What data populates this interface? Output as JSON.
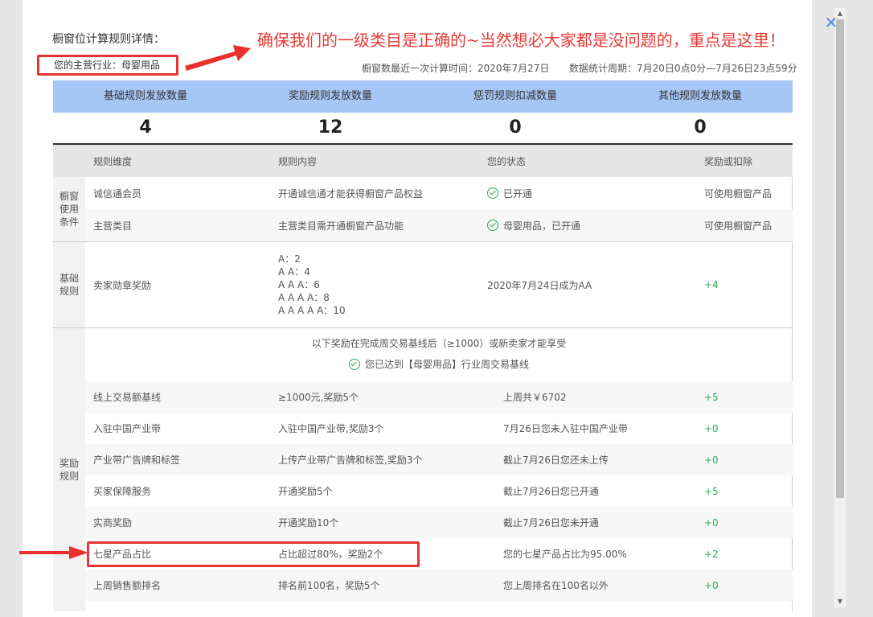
{
  "modal": {
    "title": "橱窗位计算规则详情：",
    "annotation": "确保我们的一级类目是正确的~当然想必大家都是没问题的，重点是这里！",
    "industry_label": "您的主营行业：",
    "industry_value": "母婴用品",
    "calc_time": "橱窗数最近一次计算时间：2020年7月27日",
    "period": "数据统计周期：7月20日0点0分—7月26日23点59分",
    "close_icon": "close-icon"
  },
  "summary": {
    "headers": [
      "基础规则发放数量",
      "奖励规则发放数量",
      "惩罚规则扣减数量",
      "其他规则发放数量"
    ],
    "values": [
      "4",
      "12",
      "0",
      "0"
    ]
  },
  "table": {
    "headers": [
      "规则维度",
      "规则内容",
      "您的状态",
      "奖励或扣除"
    ],
    "groups": {
      "usage": [
        "橱窗",
        "使用",
        "条件"
      ],
      "basic": [
        "基础",
        "规则"
      ],
      "reward": [
        "奖励",
        "规则"
      ]
    },
    "usage_rows": [
      {
        "dimension": "诚信通会员",
        "content": "开通诚信通才能获得橱窗产品权益",
        "status": "已开通",
        "result": "可使用橱窗产品"
      },
      {
        "dimension": "主营类目",
        "content": "主营类目需开通橱窗产品功能",
        "status": "母婴用品，已开通",
        "result": "可使用橱窗产品"
      }
    ],
    "basic_row": {
      "dimension": "卖家勋章奖励",
      "levels": [
        "A：2",
        "A A：4",
        "A A A：6",
        "A A A A：8",
        "A A A A A：10"
      ],
      "status": "2020年7月24日成为AA",
      "result": "+4"
    },
    "notice": {
      "line1": "以下奖励在完成周交易基线后（≥1000）或新卖家才能享受",
      "line2": "您已达到【母婴用品】行业周交易基线"
    },
    "reward_rows": [
      {
        "dimension": "线上交易额基线",
        "content": "≥1000元,奖励5个",
        "status": "上周共￥6702",
        "result": "+5"
      },
      {
        "dimension": "入驻中国产业带",
        "content": "入驻中国产业带,奖励3个",
        "status": "7月26日您未入驻中国产业带",
        "result": "+0"
      },
      {
        "dimension": "产业带广告牌和标签",
        "content": "上传产业带广告牌和标签,奖励3个",
        "status": "截止7月26日您还未上传",
        "result": "+0"
      },
      {
        "dimension": "买家保障服务",
        "content": "开通奖励5个",
        "status": "截止7月26日您已开通",
        "result": "+5"
      },
      {
        "dimension": "实商奖励",
        "content": "开通奖励10个",
        "status": "截止7月26日您未开通",
        "result": "+0"
      },
      {
        "dimension": "七星产品占比",
        "content": "占比超过80%，奖励2个",
        "status": "您的七星产品占比为95.00%",
        "result": "+2"
      },
      {
        "dimension": "上周销售额排名",
        "content": "排名前100名，奖励5个",
        "status": "您上周排名在100名以外",
        "result": "+0"
      }
    ]
  },
  "colors": {
    "header_blue": "#a6c6f5",
    "accent_red": "#e83a35",
    "positive_green": "#2fa853",
    "close_blue": "#4a8fd8"
  }
}
